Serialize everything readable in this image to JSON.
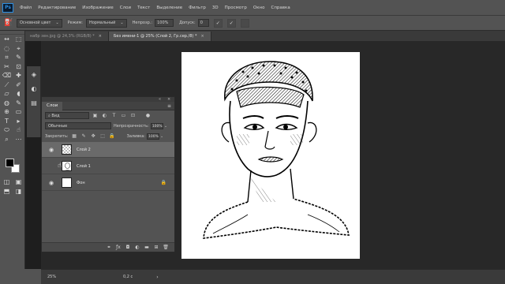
{
  "app": {
    "logo": "Ps"
  },
  "menu": [
    "Файл",
    "Редактирование",
    "Изображение",
    "Слои",
    "Текст",
    "Выделение",
    "Фильтр",
    "3D",
    "Просмотр",
    "Окно",
    "Справка"
  ],
  "options": {
    "tool_icon": "paint-bucket-icon",
    "source_select": "Основной цвет",
    "mode_label": "Режим:",
    "mode_value": "Нормальный",
    "opacity_label": "Непрозр.:",
    "opacity_value": "100%",
    "tolerance_label": "Допуск:",
    "tolerance_value": "0"
  },
  "tabs": [
    {
      "label": "набр зен.jpg @ 24,3% (RGB/8) *",
      "close": "×"
    },
    {
      "label": "Без имени-1 @ 25% (Слой 2, Гр.сер./8) *",
      "close": "×"
    }
  ],
  "tools": [
    "↔",
    "⬚",
    "◌",
    "⌖",
    "⌗",
    "✎",
    "✂",
    "⊡",
    "⌫",
    "✚",
    "⟋",
    "✐",
    "▱",
    "◖",
    "◍",
    "✎",
    "⊕",
    "▭",
    "T",
    "▸",
    "⬭",
    "☝",
    "⌕",
    "⋯"
  ],
  "tools_bottom": [
    "◫",
    "▣",
    "⬒",
    "◨"
  ],
  "layers_panel": {
    "topbar_collapse": "«",
    "topbar_close": "×",
    "tab": "Слои",
    "menu_icon": "≡",
    "filter_label": "Вид",
    "blend_mode": "Обычные",
    "opacity_label": "Непрозрачность:",
    "opacity_value": "100%",
    "lock_label": "Закрепить:",
    "fill_label": "Заливка:",
    "fill_value": "100%",
    "layers": [
      {
        "name": "Слой 2"
      },
      {
        "name": "Слой 1"
      },
      {
        "name": "Фон"
      }
    ]
  },
  "status": {
    "zoom": "25%",
    "info": "0,2 с",
    "arrow": "›"
  }
}
